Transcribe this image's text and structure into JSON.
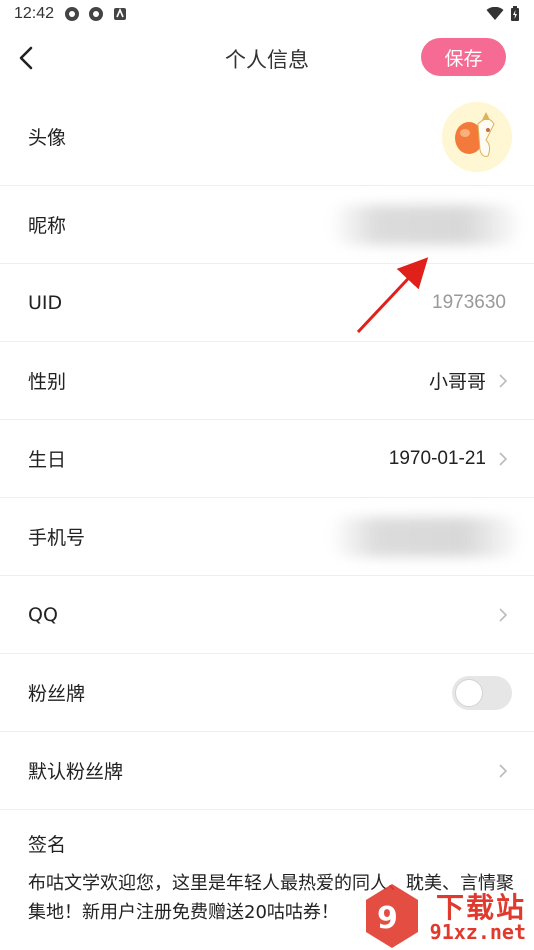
{
  "status_bar": {
    "time": "12:42"
  },
  "nav": {
    "title": "个人信息",
    "save_label": "保存"
  },
  "rows": {
    "avatar": {
      "label": "头像"
    },
    "nickname": {
      "label": "昵称"
    },
    "uid": {
      "label": "UID",
      "value": "1973630"
    },
    "gender": {
      "label": "性别",
      "value": "小哥哥"
    },
    "birthday": {
      "label": "生日",
      "value": "1970-01-21"
    },
    "phone": {
      "label": "手机号"
    },
    "qq": {
      "label": "QQ"
    },
    "fan_badge": {
      "label": "粉丝牌",
      "enabled": false
    },
    "default_badge": {
      "label": "默认粉丝牌"
    }
  },
  "signature": {
    "label": "签名",
    "text": "布咕文学欢迎您，这里是年轻人最热爱的同人、耽美、言情聚集地！新用户注册免费赠送20咕咕券！"
  },
  "watermark": {
    "brand": "下载站",
    "domain": "91xz.net"
  },
  "colors": {
    "accent": "#f66b94",
    "arrow": "#e0201a"
  }
}
